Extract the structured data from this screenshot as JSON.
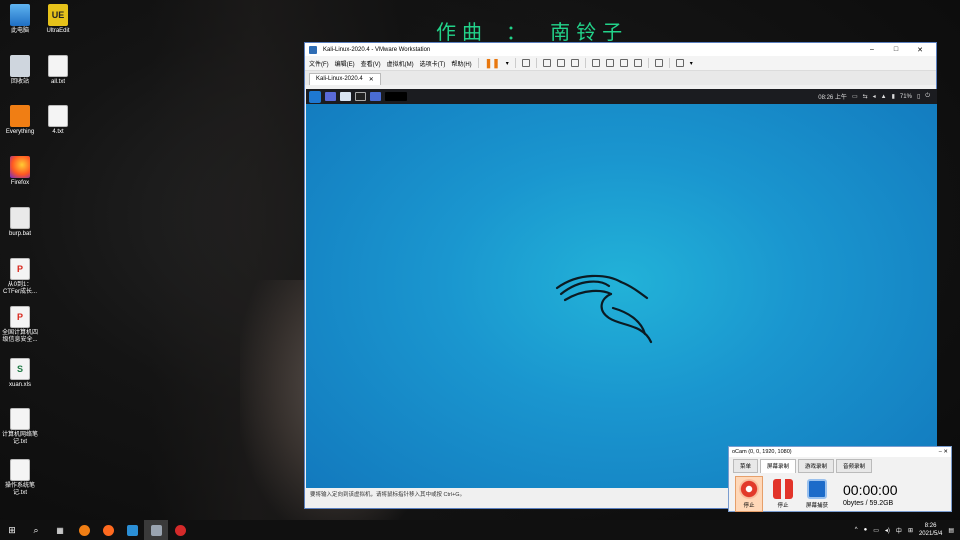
{
  "banner": "作曲 ： 南铃子",
  "desktop_icons": [
    {
      "label": "此电脑",
      "icon": "computer-icon"
    },
    {
      "label": "UltraEdit",
      "icon": "ultraedit-icon"
    },
    {
      "label": "回收站",
      "icon": "recycle-bin-icon"
    },
    {
      "label": "all.txt",
      "icon": "text-file-icon"
    },
    {
      "label": "Everything",
      "icon": "everything-search-icon"
    },
    {
      "label": "4.txt",
      "icon": "text-file-icon"
    },
    {
      "label": "Firefox",
      "icon": "firefox-icon"
    },
    {
      "label": "burp.bat",
      "icon": "batch-file-icon"
    },
    {
      "label": "从0到1：CTFer成长...",
      "icon": "pdf-icon"
    },
    {
      "label": "全国计算机四级信息安全...",
      "icon": "pdf-icon"
    },
    {
      "label": "xuan.xls",
      "icon": "spreadsheet-icon"
    },
    {
      "label": "计算机网络笔记.txt",
      "icon": "text-file-icon"
    },
    {
      "label": "操作系统笔记.txt",
      "icon": "text-file-icon"
    }
  ],
  "vmware": {
    "title": "Kali-Linux-2020.4 - VMware Workstation",
    "menu": [
      "文件(F)",
      "编辑(E)",
      "查看(V)",
      "虚拟机(M)",
      "选项卡(T)",
      "帮助(H)"
    ],
    "tab_label": "Kali-Linux-2020.4",
    "status_text": "要将输入定向到该虚拟机，请将鼠标指针移入其中或按 Ctrl+G。",
    "kali_panel": {
      "time": "08:26 上午",
      "battery": "71%"
    }
  },
  "ocam": {
    "title": "oCam (0, 0, 1920, 1080)",
    "tabs": [
      "菜单",
      "屏幕录制",
      "游戏录制",
      "音频录制"
    ],
    "active_tab": "屏幕录制",
    "buttons": [
      "停止",
      "停止",
      "屏幕捕获"
    ],
    "timer": "00:00:00",
    "size": "0bytes / 59.2GB"
  },
  "taskbar": {
    "time": "8:26",
    "date": "2021/5/4",
    "ime": "中"
  },
  "colors": {
    "banner": "#22d38a",
    "kali_bg": "#1a96cf",
    "accent": "#1e78d2"
  }
}
